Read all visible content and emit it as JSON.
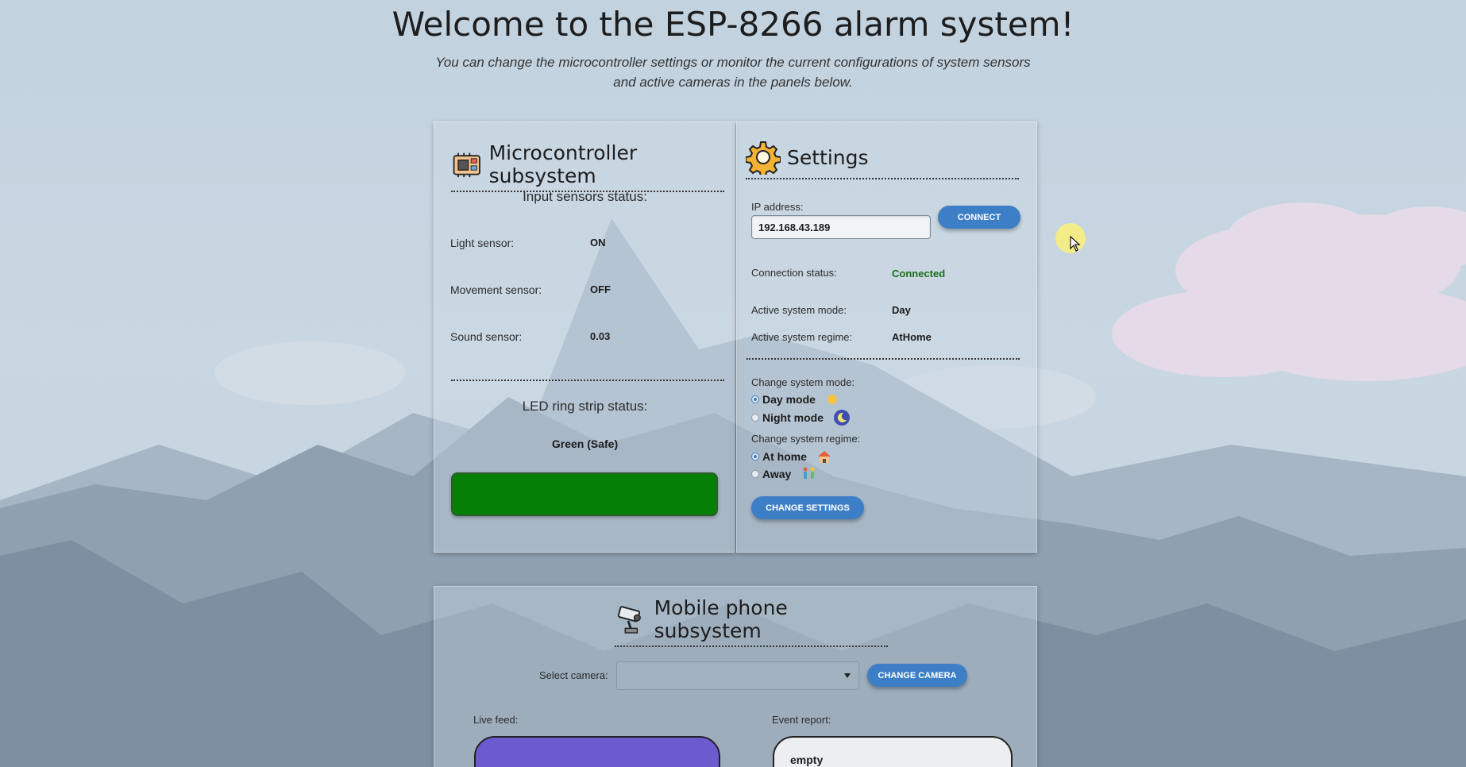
{
  "header": {
    "title": "Welcome to the ESP-8266 alarm system!",
    "subtitle": "You can change the microcontroller settings or monitor the current configurations of system sensors and active cameras in the panels below."
  },
  "micro": {
    "title": "Microcontroller subsystem",
    "icon": "microcontroller-icon",
    "sensors_heading": "Input sensors status:",
    "sensors": [
      {
        "label": "Light sensor:",
        "value": "ON"
      },
      {
        "label": "Movement sensor:",
        "value": "OFF"
      },
      {
        "label": "Sound sensor:",
        "value": "0.03"
      }
    ],
    "led_heading": "LED ring strip status:",
    "led_status": "Green (Safe)",
    "led_color": "#058005"
  },
  "settings": {
    "title": "Settings",
    "icon": "gear-icon",
    "ip_label": "IP address:",
    "ip_value": "192.168.43.189",
    "connect_label": "CONNECT",
    "connection_label": "Connection status:",
    "connection_value": "Connected",
    "mode_label": "Active system mode:",
    "mode_value": "Day",
    "regime_label": "Active system regime:",
    "regime_value": "AtHome",
    "change_mode_label": "Change system mode:",
    "mode_options": [
      {
        "label": "Day mode",
        "selected": true,
        "icon": "sun-icon"
      },
      {
        "label": "Night mode",
        "selected": false,
        "icon": "moon-icon"
      }
    ],
    "change_regime_label": "Change system regime:",
    "regime_options": [
      {
        "label": "At home",
        "selected": true,
        "icon": "house-icon"
      },
      {
        "label": "Away",
        "selected": false,
        "icon": "walking-people-icon"
      }
    ],
    "change_settings_label": "CHANGE SETTINGS"
  },
  "mobile": {
    "title": "Mobile phone subsystem",
    "icon": "security-camera-icon",
    "select_camera_label": "Select camera:",
    "select_camera_value": "",
    "change_camera_label": "CHANGE CAMERA",
    "live_feed_label": "Live feed:",
    "live_feed_color": "#6c5ad0",
    "event_report_label": "Event report:",
    "event_report_value": "empty"
  },
  "colors": {
    "accent": "#3d7fc7",
    "connected": "#1a6e1a"
  }
}
